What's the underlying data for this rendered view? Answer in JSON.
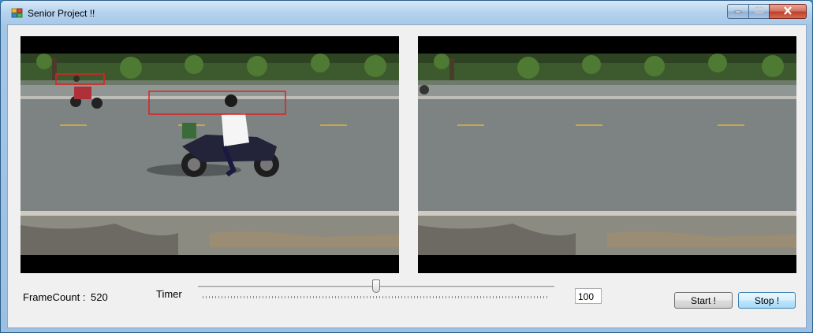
{
  "window": {
    "title": "Senior Project !!",
    "controls": {
      "minimize": "minimize",
      "maximize": "maximize",
      "close": "close"
    }
  },
  "controls": {
    "frame_count_label": "FrameCount :",
    "frame_count_value": "520",
    "timer_label": "Timer",
    "timer_value": "100",
    "slider_fraction": 0.5,
    "start_label": "Start !",
    "stop_label": "Stop !"
  },
  "icons": {
    "app": "app-icon",
    "minimize": "minimize-icon",
    "maximize": "maximize-icon",
    "close": "close-icon"
  },
  "colors": {
    "detection_box": "#e02020",
    "close_button": "#c2402a"
  }
}
